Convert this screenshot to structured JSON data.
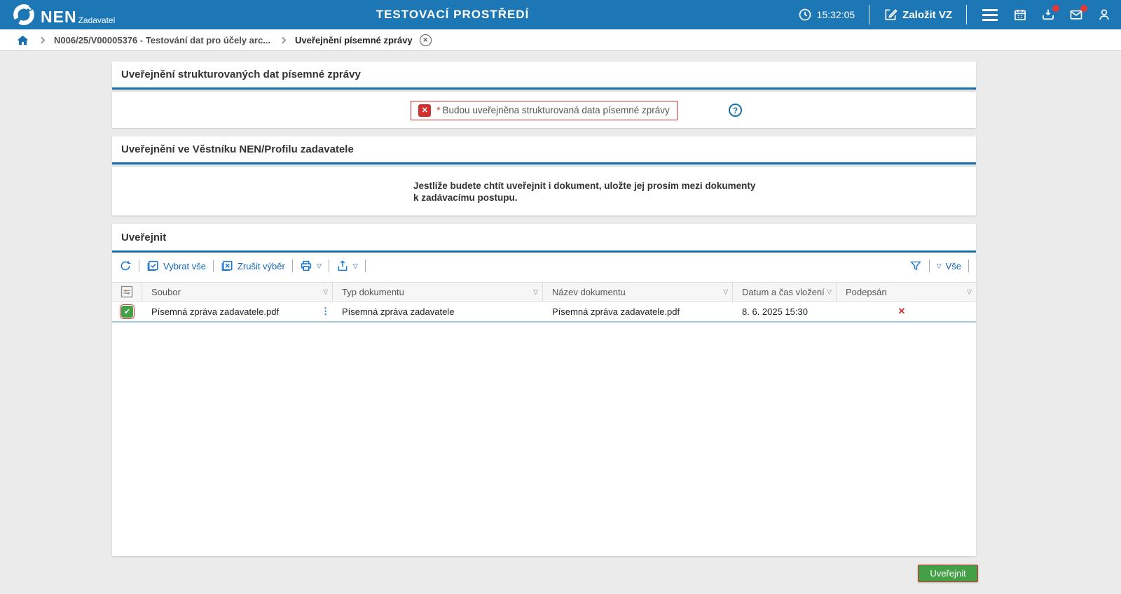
{
  "colors": {
    "header_bg": "#1d77b4",
    "accent_blue": "#1a6fad",
    "link_blue": "#1565c0",
    "error_red": "#d32f2f",
    "success_green": "#43a047",
    "badge_red": "#e53935",
    "row_highlight_border": "#9fc6e8",
    "page_bg": "#ebebeb"
  },
  "header": {
    "brand": "NEN",
    "brand_sub": "Zadavatel",
    "env_title": "TESTOVACÍ PROSTŘEDÍ",
    "clock_time": "15:32:05",
    "new_vz_label": "Založit VZ"
  },
  "breadcrumb": {
    "item1": "N006/25/V00005376 - Testování dat pro účely arc...",
    "item2": "Uveřejnění písemné zprávy"
  },
  "section_structured": {
    "title": "Uveřejnění strukturovaných dat písemné zprávy",
    "required_mark": "*",
    "checkbox_label": "Budou uveřejněna strukturovaná data písemné zprávy"
  },
  "section_vestnik": {
    "title": "Uveřejnění ve Věstníku NEN/Profilu zadavatele",
    "note_line1": "Jestliže budete chtít uveřejnit i dokument, uložte jej prosím mezi dokumenty",
    "note_line2": "k zadávacímu postupu."
  },
  "section_publish": {
    "title": "Uveřejnit",
    "toolbar": {
      "select_all": "Vybrat vše",
      "clear_selection": "Zrušit výběr",
      "filter_all": "Vše"
    },
    "table": {
      "columns": {
        "soubor": "Soubor",
        "typ": "Typ dokumentu",
        "nazev": "Název dokumentu",
        "datum": "Datum a čas vložení",
        "podepsan": "Podepsán"
      },
      "row": {
        "soubor": "Písemná zpráva zadavatele.pdf",
        "typ": "Písemná zpráva zadavatele",
        "nazev": "Písemná zpráva zadavatele.pdf",
        "datum": "8. 6. 2025 15:30",
        "podepsan_glyph": "✕"
      }
    }
  },
  "footer": {
    "publish_button": "Uveřejnit"
  },
  "glyphs": {
    "sort": "▽",
    "check": "✔",
    "cross": "✕",
    "dots": "⋮",
    "question": "?"
  }
}
